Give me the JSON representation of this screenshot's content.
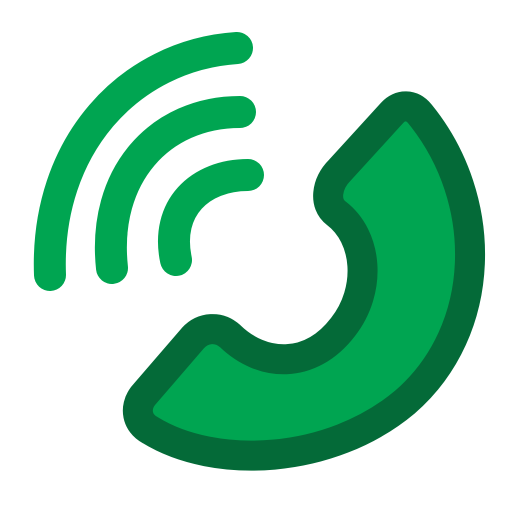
{
  "icon": {
    "name": "phone-call-icon",
    "colors": {
      "handset_fill": "#00A551",
      "handset_outline": "#046A38",
      "signal_waves": "#00A551",
      "background": "#FFFFFF"
    }
  }
}
